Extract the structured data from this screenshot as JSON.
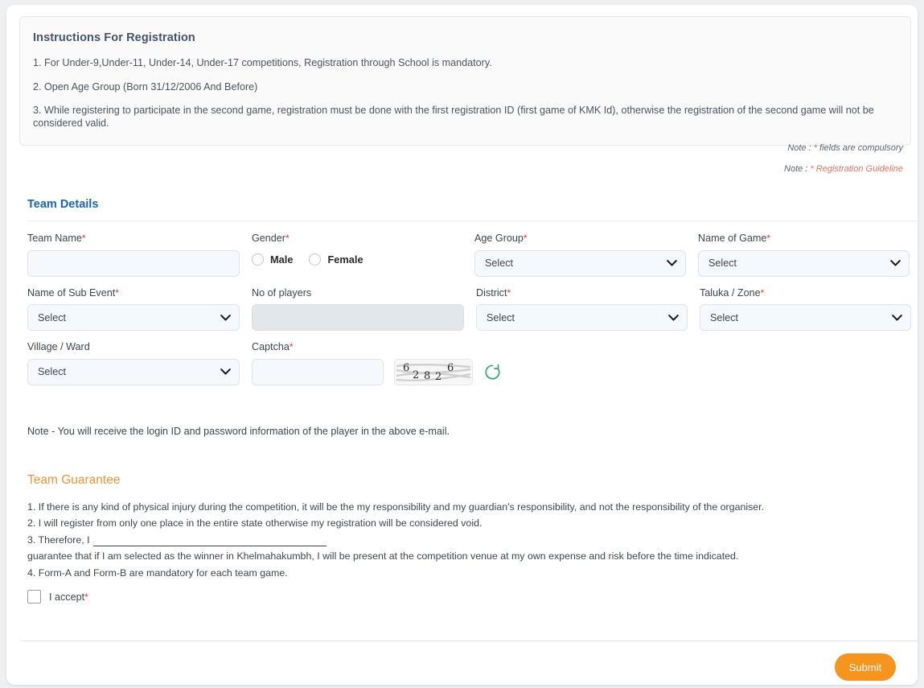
{
  "instructions": {
    "heading": "Instructions For Registration",
    "items": [
      "1. For Under-9,Under-11, Under-14, Under-17 competitions, Registration through School is mandatory.",
      "2. Open Age Group (Born 31/12/2006 And Before)",
      "3. While registering to participate in the second game, registration must be done with the first registration ID (first game of KMK Id), otherwise the registration of the second game will not be considered valid."
    ]
  },
  "notes": {
    "compulsory_prefix": "Note : ",
    "compulsory_star": "*",
    "compulsory_text": " fields are compulsory",
    "guideline_prefix": "Note : ",
    "guideline_star": "*",
    "guideline_text": " Registration Guideline"
  },
  "team_details": {
    "section_title": "Team Details",
    "fields": {
      "team_name": {
        "label": "Team Name",
        "required": "*",
        "value": "",
        "placeholder": ""
      },
      "gender": {
        "label": "Gender",
        "required": "*",
        "options": [
          "Male",
          "Female"
        ],
        "selected": ""
      },
      "age_group": {
        "label": "Age Group",
        "required": "*",
        "value": "Select"
      },
      "name_of_game": {
        "label": "Name of Game",
        "required": "*",
        "value": "Select"
      },
      "name_of_sub_event": {
        "label": "Name of Sub Event",
        "required": "*",
        "value": "Select"
      },
      "no_of_players": {
        "label": "No of players",
        "required": "",
        "value": "",
        "disabled": true
      },
      "district": {
        "label": "District",
        "required": "*",
        "value": "Select"
      },
      "taluka_zone": {
        "label": "Taluka / Zone",
        "required": "*",
        "value": "Select"
      },
      "village_ward": {
        "label": "Village / Ward",
        "required": "",
        "value": "Select"
      },
      "captcha": {
        "label": "Captcha",
        "required": "*",
        "value": "",
        "image_text": "62826"
      }
    },
    "form_note": "Note - You will receive the login ID and password information of the player in the above e-mail."
  },
  "team_guarantee": {
    "title": "Team Guarantee",
    "items": [
      "1. If there is any kind of physical injury during the competition, it will be the my responsibility and my guardian's responsibility, and not the responsibility of the organiser.",
      "2. I will register from only one place in the entire state otherwise my registration will be considered void.",
      "4. Form-A and Form-B are mandatory for each team game."
    ],
    "item3_prefix": "3. Therefore, I",
    "item3_continuation": "guarantee that if I am selected as the winner in Khelmahakumbh, I will be present at the competition venue at my own expense and risk before the time indicated.",
    "accept_label": "I accept",
    "accept_required": "*"
  },
  "footer": {
    "submit_label": "Submit"
  },
  "colors": {
    "section_blue": "#1565c0",
    "guarantee_orange": "#f59331",
    "submit_orange": "#f7941d",
    "required_red": "#e23a2e",
    "note_link": "#f0705a",
    "input_bg": "#f5f8fd",
    "disabled_bg": "#e3e7ea"
  }
}
